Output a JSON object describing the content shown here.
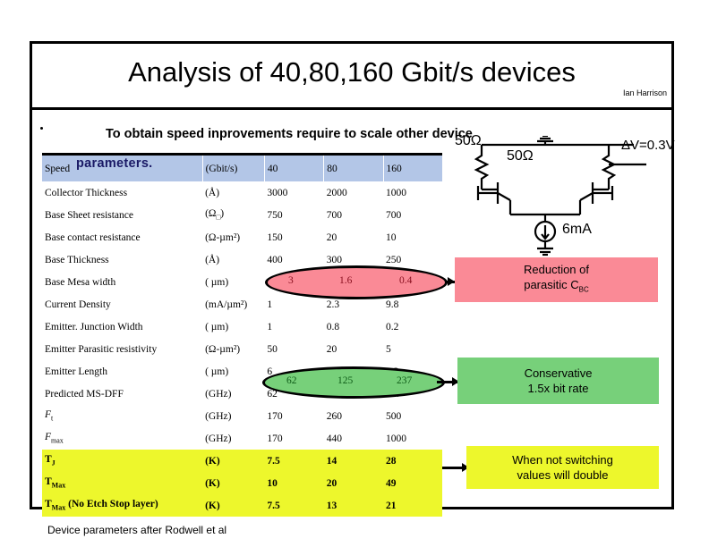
{
  "slide": {
    "title": "Analysis of 40,80,160 Gbit/s devices",
    "author": "Ian Harrison",
    "bullet": "To obtain speed inprovements require to scale other device",
    "bullet_overlap_word": "parameters.",
    "footer": "Device parameters after  Rodwell et al"
  },
  "table": {
    "header": [
      "Speed",
      "(Gbit/s)",
      "40",
      "80",
      "160"
    ],
    "rows": [
      {
        "name": "Collector Thickness",
        "unit": "(Å)",
        "values": [
          "3000",
          "2000",
          "1000"
        ]
      },
      {
        "name": "Base Sheet resistance",
        "unit": "(Ω",
        "unit_sub": "□",
        "unit_end": ")",
        "values": [
          "750",
          "700",
          "700"
        ]
      },
      {
        "name": "Base contact resistance",
        "unit": "(Ω-µm²)",
        "values": [
          "150",
          "20",
          "10"
        ]
      },
      {
        "name": "Base Thickness",
        "unit": "(Å)",
        "values": [
          "400",
          "300",
          "250"
        ]
      },
      {
        "name": "Base Mesa width",
        "unit": "( µm)",
        "values": [
          "3",
          "1.6",
          "0.4"
        ]
      },
      {
        "name": "Current Density",
        "unit": "(mA/µm²)",
        "values": [
          "1",
          "2.3",
          "9.8"
        ]
      },
      {
        "name": "Emitter.  Junction Width",
        "unit": "( µm)",
        "values": [
          "1",
          "0.8",
          "0.2"
        ]
      },
      {
        "name": "Emitter  Parasitic resistivity",
        "unit": "(Ω-µm²)",
        "values": [
          "50",
          "20",
          "5"
        ]
      },
      {
        "name": "Emitter Length",
        "unit": "( µm)",
        "values": [
          "6",
          "3.3",
          "3.2"
        ]
      },
      {
        "name": "Predicted MS-DFF",
        "unit": "(GHz)",
        "values": [
          "62",
          "125",
          "237"
        ]
      },
      {
        "name": "F",
        "name_sub": "t",
        "unit": "(GHz)",
        "values": [
          "170",
          "260",
          "500"
        ]
      },
      {
        "name": "F",
        "name_sub": "max",
        "unit": "(GHz)",
        "values": [
          "170",
          "440",
          "1000"
        ]
      },
      {
        "name": "T",
        "name_sub": "J",
        "unit": "(K)",
        "values": [
          "7.5",
          "14",
          "28"
        ]
      },
      {
        "name": "T",
        "name_sub": "Max",
        "unit": "(K)",
        "values": [
          "10",
          "20",
          "49"
        ]
      },
      {
        "name": "T",
        "name_sub": "Max",
        "name_end": " (No Etch Stop layer)",
        "unit": "(K)",
        "values": [
          "7.5",
          "13",
          "21"
        ]
      }
    ]
  },
  "highlights": {
    "pink_ellipse_values": [
      "3",
      "1.6",
      "0.4"
    ],
    "green_ellipse_values": [
      "62",
      "125",
      "237"
    ]
  },
  "callouts": {
    "pink": {
      "line1": "Reduction of",
      "line2": "parasitic C",
      "line2_sub": "BC"
    },
    "green": {
      "line1": "Conservative",
      "line2": "1.5x bit rate"
    },
    "yellow": {
      "line1": "When not switching",
      "line2": "values will double"
    }
  },
  "circuit": {
    "r_left": "50Ω",
    "r_right": "50Ω",
    "delta_v": "ΔV=0.3V",
    "current": "6mA"
  },
  "colors": {
    "header_blue": "#b3c6e7",
    "pink": "#fa8a96",
    "green": "#77d07a",
    "yellow": "#edf72c"
  }
}
